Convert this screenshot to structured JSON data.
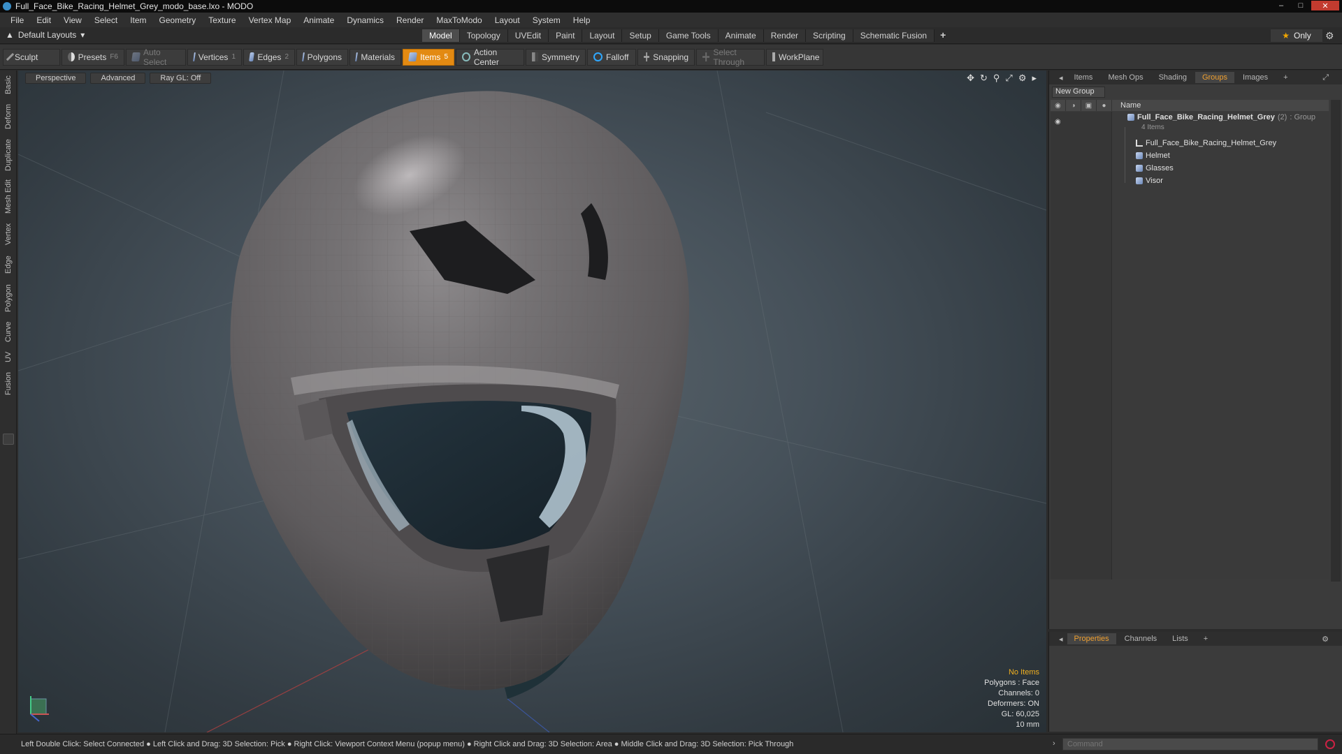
{
  "window": {
    "title": "Full_Face_Bike_Racing_Helmet_Grey_modo_base.lxo - MODO",
    "controls": [
      "minimize",
      "maximize",
      "close"
    ]
  },
  "menu": [
    "File",
    "Edit",
    "View",
    "Select",
    "Item",
    "Geometry",
    "Texture",
    "Vertex Map",
    "Animate",
    "Dynamics",
    "Render",
    "MaxToModo",
    "Layout",
    "System",
    "Help"
  ],
  "layout": {
    "dropdown": "Default Layouts",
    "tabs": [
      "Model",
      "Topology",
      "UVEdit",
      "Paint",
      "Layout",
      "Setup",
      "Game Tools",
      "Animate",
      "Render",
      "Scripting",
      "Schematic Fusion"
    ],
    "active_tab": "Model",
    "only_label": "Only"
  },
  "toolbar": {
    "sculpt": "Sculpt",
    "presets": "Presets",
    "presets_key": "F6",
    "auto_select": "Auto Select",
    "vertices": "Vertices",
    "vertices_key": "1",
    "edges": "Edges",
    "edges_key": "2",
    "polygons": "Polygons",
    "materials": "Materials",
    "items": "Items",
    "items_key": "5",
    "action_center": "Action Center",
    "symmetry": "Symmetry",
    "falloff": "Falloff",
    "snapping": "Snapping",
    "select_through": "Select Through",
    "workplane": "WorkPlane"
  },
  "left_tabs": [
    "Basic",
    "Deform",
    "Duplicate",
    "Mesh Edit",
    "Vertex",
    "Edge",
    "Polygon",
    "Curve",
    "UV",
    "Fusion"
  ],
  "viewport": {
    "view": "Perspective",
    "mode": "Advanced",
    "raygl": "Ray GL: Off",
    "stats": {
      "selection": "No Items",
      "polygons": "Polygons : Face",
      "channels": "Channels: 0",
      "deformers": "Deformers: ON",
      "gl": "GL: 60,025",
      "scale": "10 mm"
    }
  },
  "groups_panel": {
    "tabs": [
      "Items",
      "Mesh Ops",
      "Shading",
      "Groups",
      "Images"
    ],
    "active_tab": "Groups",
    "new_group": "New Group",
    "column_name": "Name",
    "group": {
      "name": "Full_Face_Bike_Racing_Helmet_Grey",
      "count": "(2)",
      "type": ": Group",
      "subtitle": "4 Items"
    },
    "children": [
      {
        "name": "Full_Face_Bike_Racing_Helmet_Grey",
        "icon": "locator-icon"
      },
      {
        "name": "Helmet",
        "icon": "mesh-icon"
      },
      {
        "name": "Glasses",
        "icon": "mesh-icon"
      },
      {
        "name": "Visor",
        "icon": "mesh-icon"
      }
    ]
  },
  "properties_panel": {
    "tabs": [
      "Properties",
      "Channels",
      "Lists"
    ],
    "active_tab": "Properties"
  },
  "status": {
    "hints": "Left Double Click: Select Connected ● Left Click and Drag: 3D Selection: Pick ● Right Click: Viewport Context Menu (popup menu) ● Right Click and Drag: 3D Selection: Area ● Middle Click and Drag: 3D Selection: Pick Through",
    "command_placeholder": "Command"
  },
  "colors": {
    "accent": "#e38a12",
    "active_tab_text": "#f0a030",
    "close_button": "#c23b2f"
  }
}
